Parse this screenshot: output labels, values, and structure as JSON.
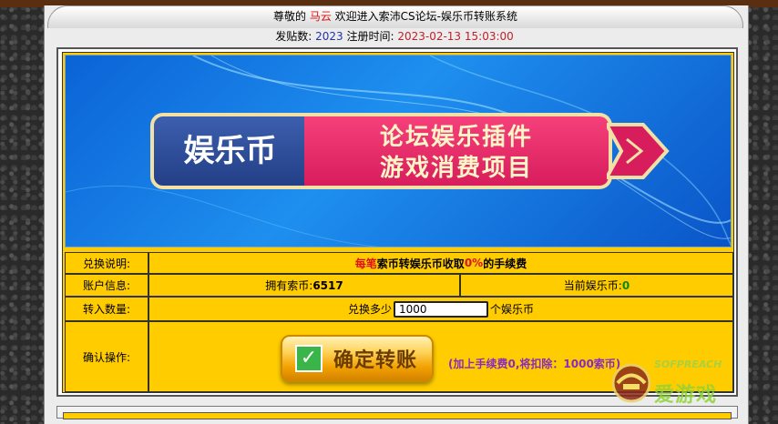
{
  "header": {
    "greeting": "尊敬的",
    "username": "马云",
    "welcome": "欢迎进入索沛CS论坛-娱乐币转账系统"
  },
  "stats": {
    "posts_label": "发贴数:",
    "posts_value": "2023",
    "reg_label": "注册时间:",
    "reg_value": "2023-02-13 15:03:00"
  },
  "banner": {
    "badge_left": "娱乐币",
    "line1": "论坛娱乐插件",
    "line2": "游戏消费项目"
  },
  "rows": {
    "exchange": {
      "label": "兑换说明:",
      "part_red1": "每笔",
      "part_mid": "索币转娱乐币收取",
      "part_red2": "0%",
      "part_end": "的手续费"
    },
    "account": {
      "label": "账户信息:",
      "owned_label": "拥有索币:",
      "owned_value": "6517",
      "current_label": "当前娱乐币:",
      "current_value": "0"
    },
    "transfer": {
      "label": "转入数量:",
      "prefix": "兑换多少",
      "input_value": "1000",
      "suffix": "个娱乐币"
    },
    "confirm": {
      "label": "确认操作:",
      "button_label": "确定转账",
      "fee_note": "(加上手续费0,将扣除：1000索币)"
    }
  },
  "watermark": {
    "line1": "SOFPREACH",
    "line2": "爱游戏"
  },
  "colors": {
    "gold": "#ffcc00",
    "accent_red": "#e0101a",
    "fee_purple": "#8a2bbf"
  }
}
